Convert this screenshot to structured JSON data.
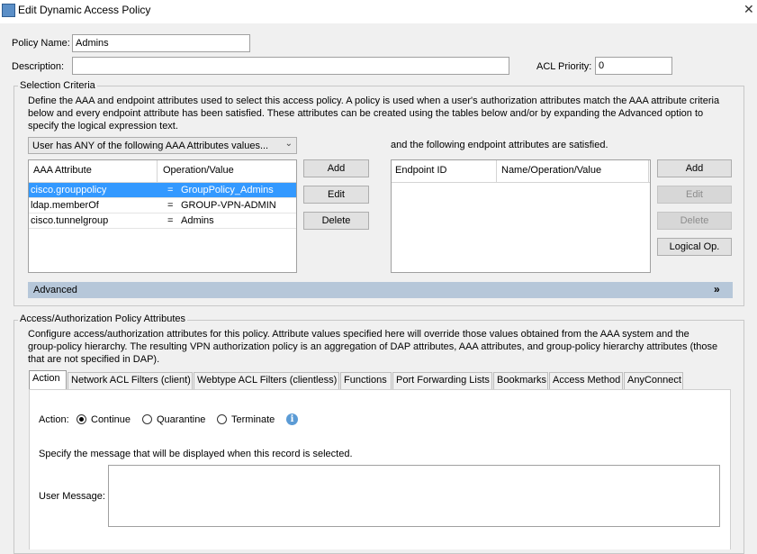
{
  "window": {
    "title": "Edit Dynamic Access Policy"
  },
  "policy": {
    "name_label": "Policy Name:",
    "name_value": "Admins",
    "description_label": "Description:",
    "description_value": "",
    "acl_priority_label": "ACL Priority:",
    "acl_priority_value": "0"
  },
  "selection_criteria": {
    "legend": "Selection Criteria",
    "description_lines": [
      "Define the AAA and endpoint attributes used to select this access policy. A policy is used when a user's authorization attributes match the AAA attribute criteria",
      "below and every endpoint attribute has been satisfied. These attributes can be created using the tables below and/or by expanding the Advanced option to",
      "specify the logical expression text."
    ],
    "aaa_match_select": "User has ANY of the following AAA Attributes values...",
    "endpoint_caption": "and the following endpoint attributes are satisfied.",
    "aaa_table": {
      "headers": [
        "AAA Attribute",
        "Operation/Value"
      ],
      "rows": [
        {
          "attribute": "cisco.grouppolicy",
          "op": "=",
          "value": "GroupPolicy_Admins",
          "selected": true
        },
        {
          "attribute": "ldap.memberOf",
          "op": "=",
          "value": "GROUP-VPN-ADMIN",
          "selected": false
        },
        {
          "attribute": "cisco.tunnelgroup",
          "op": "=",
          "value": "Admins",
          "selected": false
        }
      ]
    },
    "aaa_buttons": {
      "add": "Add",
      "edit": "Edit",
      "delete": "Delete"
    },
    "endpoint_table": {
      "headers": [
        "Endpoint ID",
        "Name/Operation/Value"
      ],
      "rows": []
    },
    "endpoint_buttons": {
      "add": "Add",
      "edit": "Edit",
      "delete": "Delete",
      "logical_op": "Logical Op."
    },
    "advanced_label": "Advanced",
    "advanced_icon": "double-chevron-down-icon"
  },
  "access_policy": {
    "legend": "Access/Authorization Policy Attributes",
    "description_lines": [
      "Configure access/authorization attributes for this policy. Attribute values specified here will override those values obtained from the AAA system and the",
      "group-policy hierarchy. The resulting VPN authorization policy is an aggregation of DAP attributes, AAA attributes, and group-policy hierarchy attributes (those",
      "that are not specified in DAP)."
    ],
    "tabs": [
      "Action",
      "Network ACL Filters (client)",
      "Webtype ACL Filters (clientless)",
      "Functions",
      "Port Forwarding Lists",
      "Bookmarks",
      "Access Method",
      "AnyConnect"
    ],
    "active_tab": "Action",
    "action": {
      "label": "Action:",
      "options": [
        "Continue",
        "Quarantine",
        "Terminate"
      ],
      "selected": "Continue",
      "info_icon": "info-icon"
    },
    "message_hint": "Specify the message that will be displayed when this record is selected.",
    "user_message_label": "User Message:",
    "user_message_value": ""
  },
  "colors": {
    "selection": "#3399ff",
    "advanced_bar": "#b6c7d9",
    "info_icon": "#5b9bd5"
  }
}
